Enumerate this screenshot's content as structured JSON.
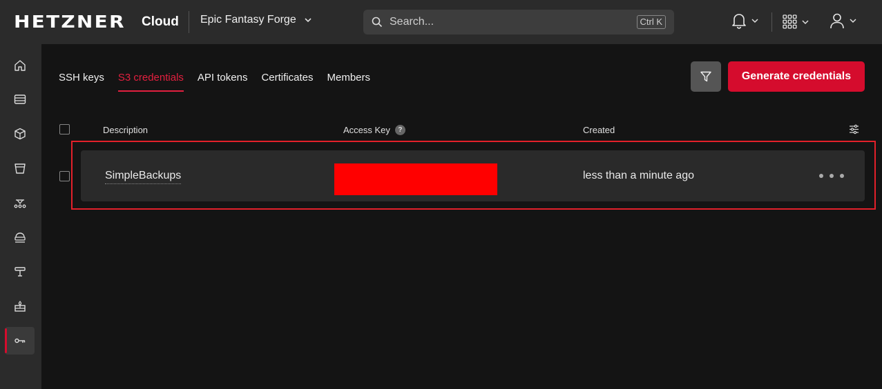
{
  "header": {
    "logo": "HETZNER",
    "product": "Cloud",
    "project": "Epic Fantasy Forge",
    "search_placeholder": "Search...",
    "search_shortcut": "Ctrl K"
  },
  "sidebar": {
    "items": [
      {
        "icon": "home-icon",
        "active": false
      },
      {
        "icon": "servers-icon",
        "active": false
      },
      {
        "icon": "volumes-icon",
        "active": false
      },
      {
        "icon": "object-storage-icon",
        "active": false
      },
      {
        "icon": "load-balancers-icon",
        "active": false
      },
      {
        "icon": "networks-icon",
        "active": false
      },
      {
        "icon": "floating-ips-icon",
        "active": false
      },
      {
        "icon": "firewalls-icon",
        "active": false
      },
      {
        "icon": "security-key-icon",
        "active": true
      }
    ]
  },
  "tabs": [
    {
      "label": "SSH keys",
      "active": false
    },
    {
      "label": "S3 credentials",
      "active": true
    },
    {
      "label": "API tokens",
      "active": false
    },
    {
      "label": "Certificates",
      "active": false
    },
    {
      "label": "Members",
      "active": false
    }
  ],
  "actions": {
    "generate_label": "Generate credentials"
  },
  "table": {
    "columns": {
      "description": "Description",
      "access_key": "Access Key",
      "access_key_help": "?",
      "created": "Created"
    },
    "rows": [
      {
        "description": "SimpleBackups",
        "access_key": "",
        "created": "less than a minute ago"
      }
    ]
  },
  "colors": {
    "accent": "#d50c2d",
    "topbar": "#2b2b2b",
    "background": "#141414",
    "redaction": "#ff0000"
  }
}
